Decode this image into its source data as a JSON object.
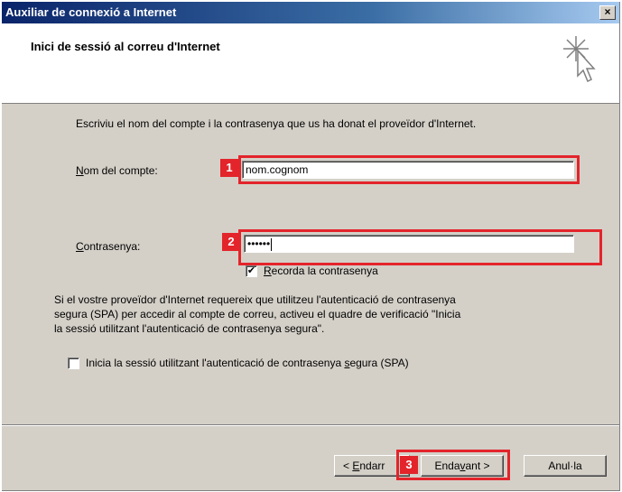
{
  "window": {
    "title": "Auxiliar de connexió a Internet",
    "close_glyph": "×"
  },
  "header": {
    "title": "Inici de sessió al correu d'Internet"
  },
  "intro_text": "Escriviu el nom del compte i la contrasenya que us ha donat el proveïdor d'Internet.",
  "account": {
    "label_mnemonic": "N",
    "label_rest": "om del compte:",
    "value": "nom.cognom",
    "callout_number": "1"
  },
  "password": {
    "label_mnemonic": "C",
    "label_rest": "ontrasenya:",
    "value": "••••••",
    "callout_number": "2",
    "remember_checked": true,
    "remember_check_glyph": "✔",
    "remember_mnemonic": "R",
    "remember_rest": "ecorda la contrasenya"
  },
  "spa": {
    "note_lines": [
      "Si el vostre proveïdor d'Internet requereix que utilitzeu l'autenticació de contrasenya",
      "segura (SPA) per accedir al  compte de correu, activeu el quadre de verificació \"Inicia",
      "la sessió utilitzant l'autenticació de contrasenya segura\"."
    ],
    "checkbox_checked": false,
    "label_pre": "Inicia la sessió utilitzant l'autenticació de contrasenya ",
    "label_mnemonic": "s",
    "label_post": "egura (SPA)"
  },
  "buttons": {
    "back_pre": "< ",
    "back_mnemonic": "E",
    "back_rest": "ndarr",
    "next_pre": "Enda",
    "next_mnemonic": "v",
    "next_post": "ant >",
    "next_callout_number": "3",
    "cancel_label": "Anul·la"
  },
  "colors": {
    "callout": "#e3242b",
    "title_bar": "#0a246a",
    "dialog_bg": "#d4d0c8"
  }
}
